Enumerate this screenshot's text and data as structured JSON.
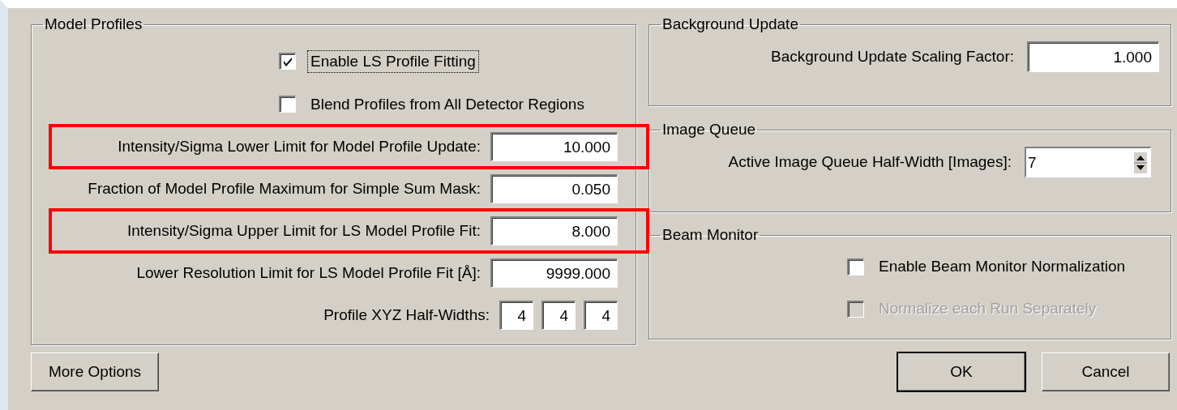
{
  "model_profiles": {
    "title": "Model Profiles",
    "checkboxes": [
      {
        "label": "Enable LS Profile Fitting",
        "checked": true,
        "focused": true
      },
      {
        "label": "Blend Profiles from All Detector Regions",
        "checked": false,
        "focused": false
      }
    ],
    "fields": [
      {
        "label": "Intensity/Sigma Lower Limit for Model Profile Update:",
        "values": [
          "10.000"
        ],
        "highlighted": true
      },
      {
        "label": "Fraction of Model Profile Maximum for Simple Sum Mask:",
        "values": [
          "0.050"
        ],
        "highlighted": false
      },
      {
        "label": "Intensity/Sigma Upper Limit for LS Model Profile Fit:",
        "values": [
          "8.000"
        ],
        "highlighted": true
      },
      {
        "label": "Lower Resolution Limit for LS Model Profile Fit [Å]:",
        "values": [
          "9999.000"
        ],
        "highlighted": false
      },
      {
        "label": "Profile XYZ Half-Widths:",
        "values": [
          "4",
          "4",
          "4"
        ],
        "highlighted": false
      }
    ]
  },
  "more_options_button": "More Options",
  "background_update": {
    "title": "Background Update",
    "field": {
      "label": "Background Update Scaling Factor:",
      "value": "1.000"
    }
  },
  "image_queue": {
    "title": "Image Queue",
    "spinner": {
      "label": "Active Image Queue Half-Width [Images]:",
      "value": "7"
    }
  },
  "beam_monitor": {
    "title": "Beam Monitor",
    "checkboxes": [
      {
        "label": "Enable Beam Monitor Normalization",
        "checked": false,
        "disabled": false
      },
      {
        "label": "Normalize each Run Separately",
        "checked": false,
        "disabled": true
      }
    ]
  },
  "buttons": [
    {
      "label": "OK",
      "default": true
    },
    {
      "label": "Cancel",
      "default": false
    }
  ]
}
